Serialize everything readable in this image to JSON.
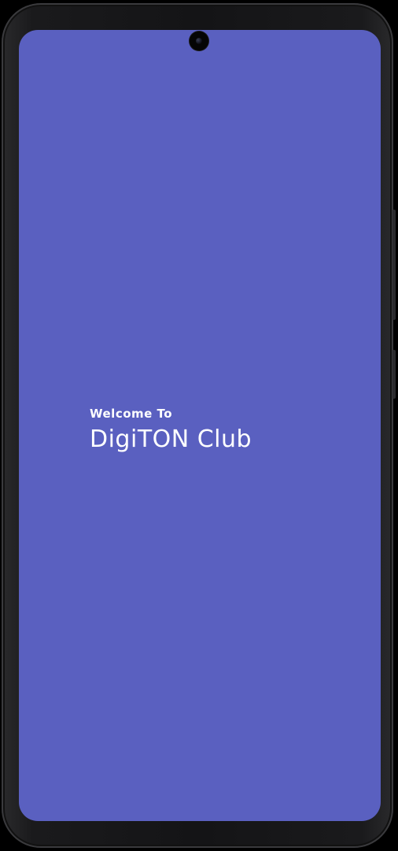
{
  "colors": {
    "screen_background": "#5a60c0",
    "text": "#ffffff",
    "device_frame": "#141416"
  },
  "splash": {
    "welcome_line": "Welcome To",
    "app_name": "DigiTON Club"
  },
  "icons": {
    "front_camera": "camera-icon"
  }
}
